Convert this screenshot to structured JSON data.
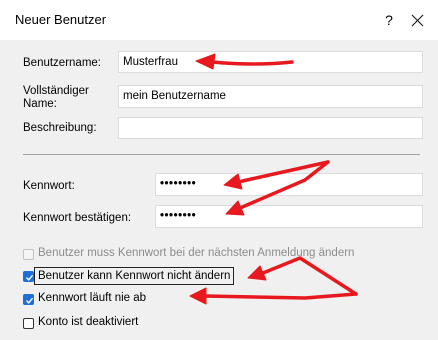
{
  "window": {
    "title": "Neuer Benutzer",
    "help_label": "?",
    "close_icon": "close-icon"
  },
  "form": {
    "username_label": "Benutzername:",
    "username_value": "Musterfrau",
    "fullname_label_line1": "Vollständiger",
    "fullname_label_line2": "Name:",
    "fullname_value": "mein Benutzername",
    "description_label": "Beschreibung:",
    "description_value": "",
    "password_label": "Kennwort:",
    "password_value": "••••••••",
    "confirm_label": "Kennwort bestätigen:",
    "confirm_value": "••••••••"
  },
  "options": [
    {
      "label": "Benutzer muss Kennwort bei der nächsten Anmeldung ändern",
      "checked": false,
      "disabled": true
    },
    {
      "label": "Benutzer kann Kennwort nicht ändern",
      "checked": true,
      "disabled": false,
      "focused": true
    },
    {
      "label": "Kennwort läuft nie ab",
      "checked": true,
      "disabled": false
    },
    {
      "label": "Konto ist deaktiviert",
      "checked": false,
      "disabled": false
    }
  ],
  "colors": {
    "checkbox_checked": "#1e6fd9",
    "annotation_arrow": "#e8191e"
  }
}
